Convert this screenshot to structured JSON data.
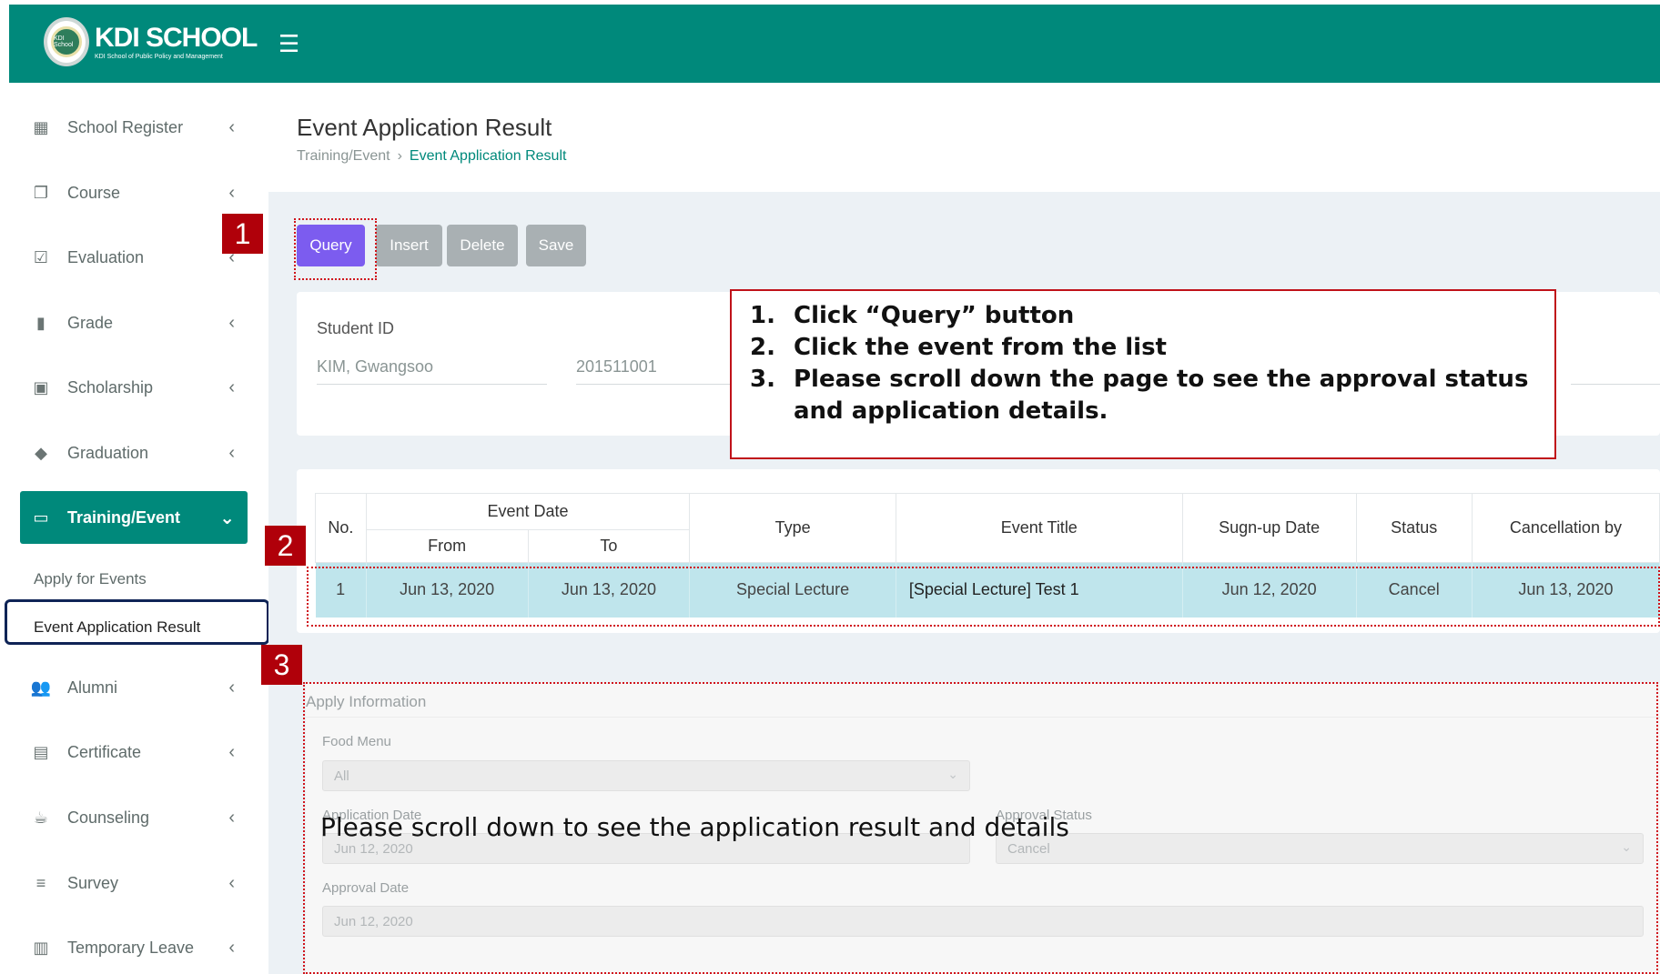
{
  "header": {
    "logo_title": "KDI SCHOOL",
    "logo_subtitle": "KDI School of Public Policy and Management",
    "logo_badge": "KDI School",
    "menu_icon": "hamburger-icon"
  },
  "sidebar": {
    "items": [
      {
        "label": "School Register",
        "icon": "grid-icon"
      },
      {
        "label": "Course",
        "icon": "copy-icon"
      },
      {
        "label": "Evaluation",
        "icon": "checkbox-icon"
      },
      {
        "label": "Grade",
        "icon": "bar-chart-icon"
      },
      {
        "label": "Scholarship",
        "icon": "book-icon"
      },
      {
        "label": "Graduation",
        "icon": "graduation-cap-icon"
      },
      {
        "label": "Training/Event",
        "icon": "monitor-icon"
      },
      {
        "label": "Alumni",
        "icon": "people-icon"
      },
      {
        "label": "Certificate",
        "icon": "certificate-icon"
      },
      {
        "label": "Counseling",
        "icon": "coffee-icon"
      },
      {
        "label": "Survey",
        "icon": "checklist-icon"
      },
      {
        "label": "Temporary Leave",
        "icon": "calendar-icon"
      }
    ],
    "sub_items": [
      "Apply for Events",
      "Event Application Result"
    ]
  },
  "page": {
    "title": "Event Application Result",
    "breadcrumb": [
      "Training/Event",
      "Event Application Result"
    ],
    "buttons": {
      "query": "Query",
      "insert": "Insert",
      "delete": "Delete",
      "save": "Save"
    },
    "search": {
      "label": "Student ID",
      "name": "KIM, Gwangsoo",
      "id": "201511001"
    }
  },
  "grid": {
    "headers": {
      "no": "No.",
      "event_date": "Event Date",
      "from": "From",
      "to": "To",
      "type": "Type",
      "title": "Event Title",
      "signup": "Sugn-up Date",
      "status": "Status",
      "cancel": "Cancellation by"
    },
    "rows": [
      {
        "no": "1",
        "from": "Jun 13, 2020",
        "to": "Jun 13, 2020",
        "type": "Special Lecture",
        "title": "[Special Lecture] Test 1",
        "signup": "Jun 12, 2020",
        "status": "Cancel",
        "cancel": "Jun 13, 2020"
      }
    ]
  },
  "apply": {
    "title": "Apply Information",
    "food_label": "Food Menu",
    "food_value": "All",
    "app_date_label": "Application Date",
    "app_date_value": "Jun 12, 2020",
    "approval_status_label": "Approval Status",
    "approval_status_value": "Cancel",
    "approval_date_label": "Approval Date",
    "approval_date_value": "Jun 12, 2020"
  },
  "annotations": {
    "num1": "1",
    "num2": "2",
    "num3": "3",
    "steps": [
      {
        "n": "1.",
        "text": "Click “Query” button"
      },
      {
        "n": "2.",
        "text": "Click the event from the list"
      },
      {
        "n": "3.",
        "text": "Please scroll down the page to see the approval status and application details."
      }
    ],
    "scroll_note": "Please scroll down to see the application result and details"
  }
}
